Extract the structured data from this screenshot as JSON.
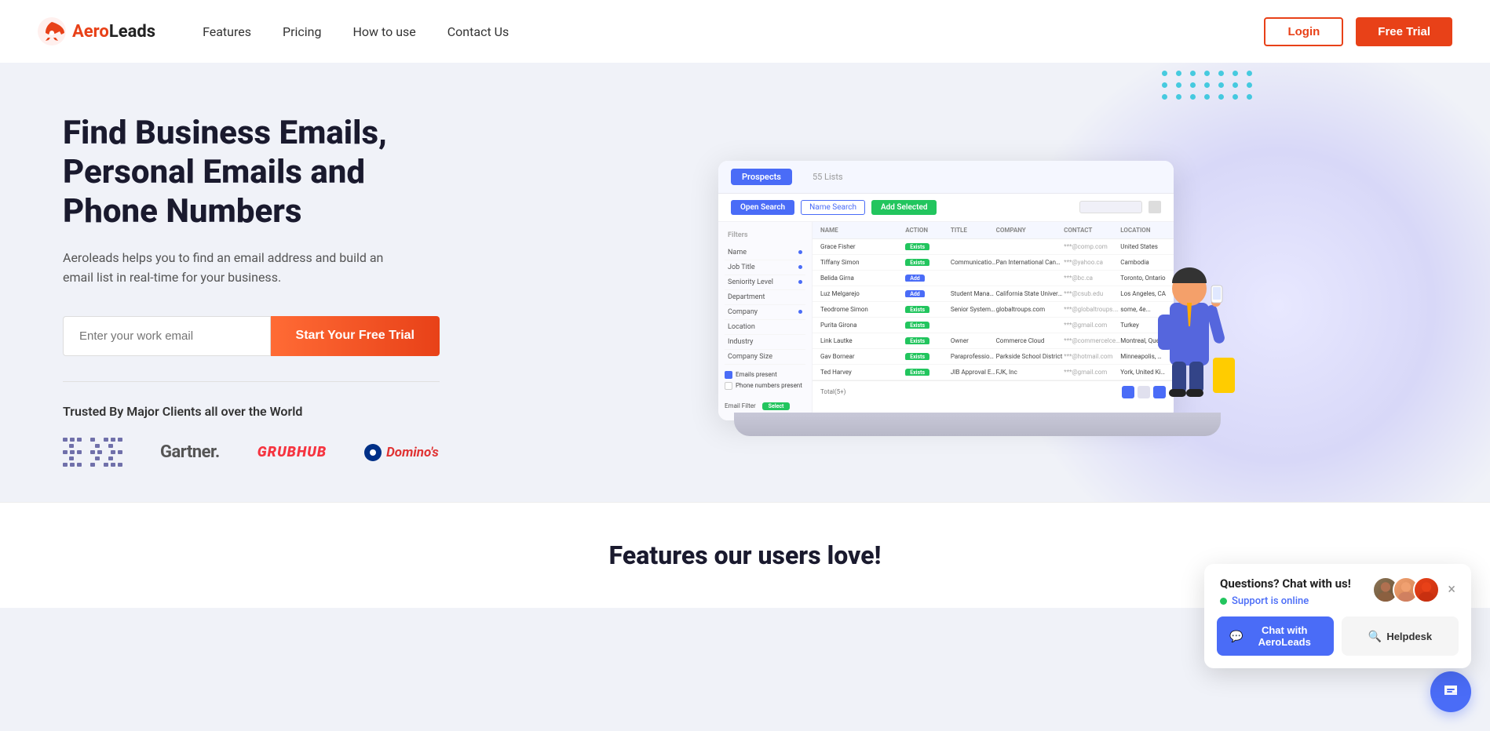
{
  "nav": {
    "logo_text_1": "Aero",
    "logo_text_2": "Leads",
    "links": [
      {
        "label": "Features",
        "id": "features"
      },
      {
        "label": "Pricing",
        "id": "pricing"
      },
      {
        "label": "How to use",
        "id": "how-to-use"
      },
      {
        "label": "Contact Us",
        "id": "contact"
      }
    ],
    "login_label": "Login",
    "free_trial_label": "Free Trial"
  },
  "hero": {
    "title": "Find Business Emails, Personal Emails and Phone Numbers",
    "subtitle": "Aeroleads helps you to find an email address and build an email list in real-time for your business.",
    "email_placeholder": "Enter your work email",
    "cta_label": "Start Your Free Trial",
    "trusted_text": "Trusted By Major Clients all over the World",
    "logos": [
      "IBM",
      "Gartner.",
      "GRUBHUB",
      "Domino's"
    ]
  },
  "dashboard": {
    "tab_prospects": "Prospects",
    "tab_lists": "55 Lists",
    "btn_open_search": "Open Search",
    "btn_name_search": "Name Search",
    "btn_add_selected": "Add Selected",
    "filters_title": "Filters",
    "filters": [
      "Name",
      "Job Title",
      "Seniority Level",
      "Department",
      "Company",
      "Location",
      "Industry",
      "Company Size"
    ],
    "columns": [
      "Name",
      "Action",
      "Title",
      "Company",
      "Contact",
      "Location"
    ],
    "rows": [
      {
        "name": "Grace Fisher",
        "action": "Exists",
        "title": "",
        "company": "",
        "contact": "***@comp.com",
        "location": "United States"
      },
      {
        "name": "Tiffany Simon",
        "action": "Exists",
        "title": "Communications Officer",
        "company": "Pan International Canmore",
        "contact": "***@yahoo.ca",
        "location": "Cambodia"
      },
      {
        "name": "Belida Girna",
        "action": "Add",
        "title": "",
        "company": "",
        "contact": "***@bc.ca",
        "location": "Toronto, Ontario, Cana"
      },
      {
        "name": "Luz Melgarejo",
        "action": "Add",
        "title": "Student Manager Of Module",
        "company": "California State University Bakersfield",
        "contact": "***@csub.edu",
        "location": "Los Angeles, CA"
      },
      {
        "name": "Teodrome Simon",
        "action": "Exists",
        "title": "Senior Systems Administrator",
        "company": "globaltroups.com",
        "contact": "***@globaltroups.com",
        "location": "some, 4e..."
      },
      {
        "name": "Purita Girona",
        "action": "Exists",
        "title": "",
        "company": "",
        "contact": "***@gmail.com",
        "location": "Turkey"
      },
      {
        "name": "Link Lautke",
        "action": "Exists",
        "title": "Owner",
        "company": "Commerce Cloud",
        "contact": "***@commercelce.ca",
        "location": "Montreal, Quebe"
      },
      {
        "name": "Gav Bornear",
        "action": "Exists",
        "title": "Paraprofessional",
        "company": "Parkside School District",
        "contact": "***@hotmail.com",
        "location": "Minneapolis, Mir"
      },
      {
        "name": "Ted Harvey",
        "action": "Exists",
        "title": "JIB Approval Electrician",
        "company": "FJK, Inc",
        "contact": "***@gmail.com",
        "location": "York, United Kinge"
      }
    ]
  },
  "chat_widget": {
    "heading": "Questions? Chat with us!",
    "status_text": "Support is online",
    "close_label": "×",
    "btn_chat_label": "Chat with AeroLeads",
    "btn_helpdesk_label": "Helpdesk"
  },
  "features_section": {
    "title": "Features our users love!"
  },
  "colors": {
    "primary": "#e84118",
    "blue": "#4a6cf7",
    "green": "#22c55e"
  }
}
